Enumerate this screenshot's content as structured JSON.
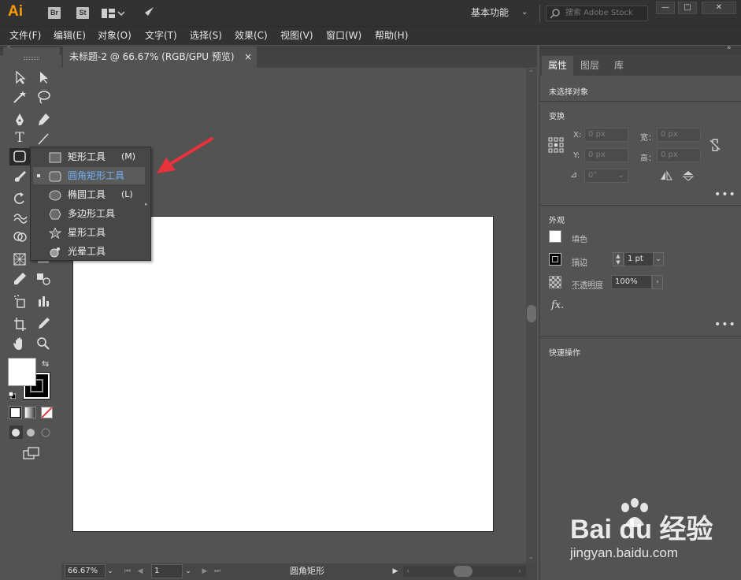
{
  "app": {
    "logo": "Ai",
    "bridge_label": "Br",
    "stock_label": "St",
    "workspace": "基本功能",
    "search_placeholder": "搜索 Adobe Stock"
  },
  "menu": [
    "文件(F)",
    "编辑(E)",
    "对象(O)",
    "文字(T)",
    "选择(S)",
    "效果(C)",
    "视图(V)",
    "窗口(W)",
    "帮助(H)"
  ],
  "document": {
    "tab_title": "未标题-2 @ 66.67% (RGB/GPU 预览)",
    "close_glyph": "×"
  },
  "flyout": [
    {
      "label": "矩形工具",
      "key": "(M)",
      "icon": "rectangle-icon",
      "selected": false
    },
    {
      "label": "圆角矩形工具",
      "key": "",
      "icon": "rounded-rectangle-icon",
      "selected": true
    },
    {
      "label": "椭圆工具",
      "key": "(L)",
      "icon": "ellipse-icon",
      "selected": false
    },
    {
      "label": "多边形工具",
      "key": "",
      "icon": "polygon-icon",
      "selected": false
    },
    {
      "label": "星形工具",
      "key": "",
      "icon": "star-icon",
      "selected": false
    },
    {
      "label": "光晕工具",
      "key": "",
      "icon": "flare-icon",
      "selected": false
    }
  ],
  "statusbar": {
    "zoom": "66.67%",
    "artboard": "1",
    "status_text": "圆角矩形"
  },
  "panel": {
    "tabs": [
      "属性",
      "图层",
      "库"
    ],
    "no_selection": "未选择对象",
    "transform_title": "变换",
    "x_label": "X:",
    "x_value": "0 px",
    "y_label": "Y:",
    "y_value": "0 px",
    "w_label": "宽：",
    "w_value": "0 px",
    "h_label": "高：",
    "h_value": "0 px",
    "angle_value": "0°",
    "appearance_title": "外观",
    "fill_label": "填色",
    "stroke_label": "描边",
    "stroke_value": "1 pt",
    "opacity_label": "不透明度",
    "opacity_value": "100%",
    "fx_label": "fx.",
    "quick_actions_title": "快速操作",
    "more": "•••"
  },
  "watermark": {
    "brand": "Bai du 经验",
    "url": "jingyan.baidu.com"
  },
  "colors": {
    "ui_dark": "#323232",
    "ui_mid": "#535353",
    "accent_blue": "#6fb1f5",
    "arrow_red": "#e8323c"
  }
}
